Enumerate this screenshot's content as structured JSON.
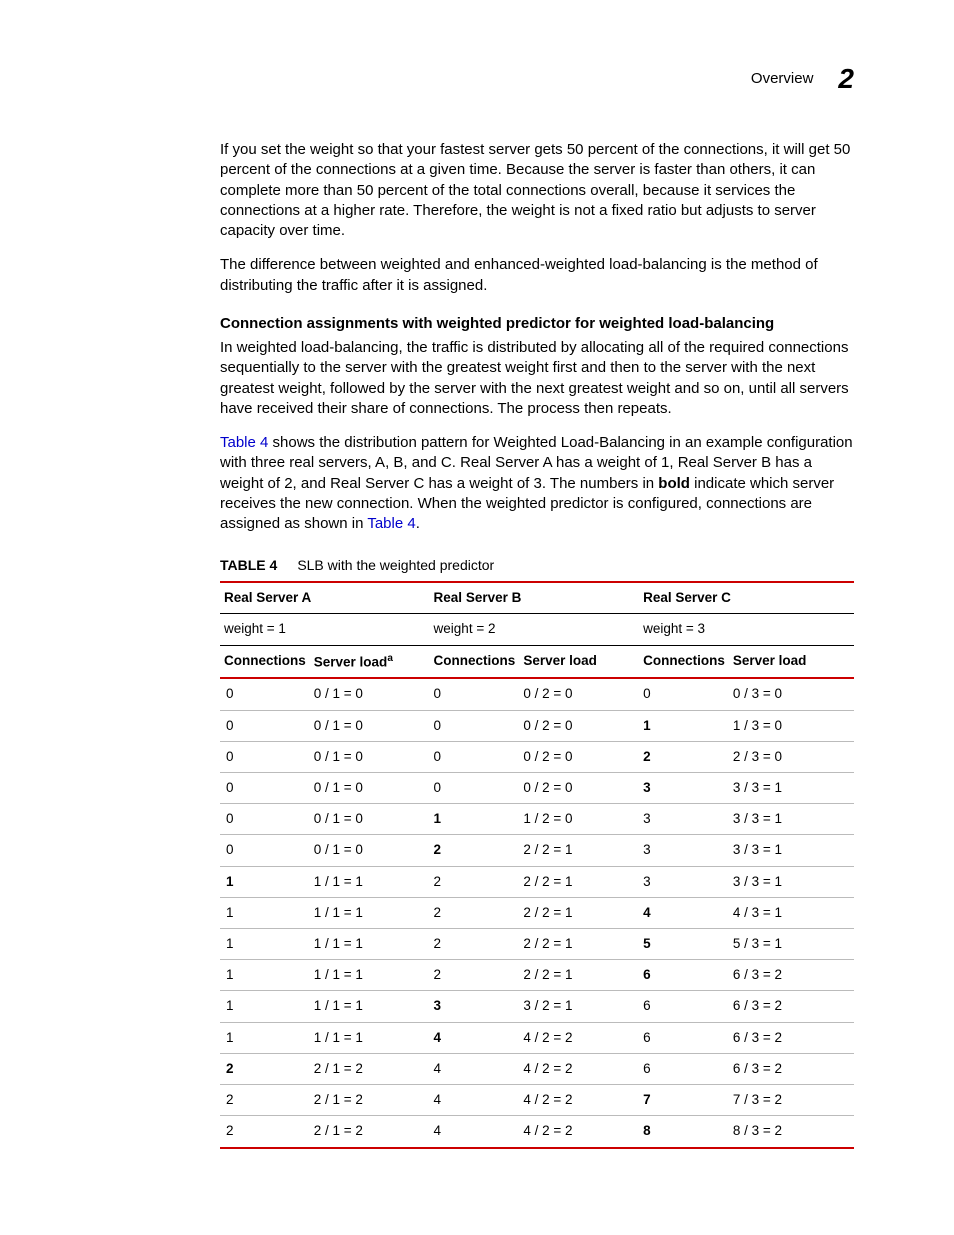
{
  "header": {
    "section": "Overview",
    "chapter": "2"
  },
  "paragraphs": {
    "p1": "If you set the weight so that your fastest server gets 50 percent of the connections, it will get 50 percent of the connections at a given time. Because the server is faster than others, it can complete more than 50 percent of the total connections overall, because it services the connections at a higher rate. Therefore, the weight is not a fixed ratio but adjusts to server capacity over time.",
    "p2": "The difference between weighted and enhanced-weighted load-balancing is the method of distributing the traffic after it is assigned.",
    "subhead": "Connection assignments with weighted predictor for weighted load-balancing",
    "p3": "In weighted load-balancing, the traffic is distributed by allocating all of the required connections sequentially to the server with the greatest weight first and then to the server with the next greatest weight, followed by the server with the next greatest weight and so on, until all servers have received their share of connections. The process then repeats.",
    "p4_link1": "Table 4",
    "p4_a": " shows the distribution pattern for Weighted Load-Balancing in an example configuration with three real servers, A, B, and C. Real Server A has a weight of 1, Real Server B has a weight of 2, and Real Server C has a weight of 3. The numbers in ",
    "p4_bold": "bold",
    "p4_b": " indicate which server receives the new connection. When the weighted predictor is configured, connections are assigned as shown in ",
    "p4_link2": "Table 4",
    "p4_c": "."
  },
  "table": {
    "caption_label": "TABLE 4",
    "caption_text": "SLB with the weighted predictor",
    "group_headers": [
      "Real Server A",
      "Real Server B",
      "Real Server C"
    ],
    "weight_headers": [
      "weight = 1",
      "weight = 2",
      "weight = 3"
    ],
    "col_headers": {
      "conn": "Connections",
      "load": "Server load",
      "load_a": "Server load",
      "sup": "a"
    },
    "rows": [
      {
        "a_c": "0",
        "a_b": false,
        "a_l": "0 / 1 = 0",
        "b_c": "0",
        "b_b": false,
        "b_l": "0 / 2 = 0",
        "c_c": "0",
        "c_b": false,
        "c_l": "0 / 3 = 0"
      },
      {
        "a_c": "0",
        "a_b": false,
        "a_l": "0 / 1 = 0",
        "b_c": "0",
        "b_b": false,
        "b_l": "0 / 2 = 0",
        "c_c": "1",
        "c_b": true,
        "c_l": "1 / 3 = 0"
      },
      {
        "a_c": "0",
        "a_b": false,
        "a_l": "0 / 1 = 0",
        "b_c": "0",
        "b_b": false,
        "b_l": "0 / 2 = 0",
        "c_c": "2",
        "c_b": true,
        "c_l": "2 / 3 = 0"
      },
      {
        "a_c": "0",
        "a_b": false,
        "a_l": "0 / 1 = 0",
        "b_c": "0",
        "b_b": false,
        "b_l": "0 / 2 = 0",
        "c_c": "3",
        "c_b": true,
        "c_l": "3 / 3 = 1"
      },
      {
        "a_c": "0",
        "a_b": false,
        "a_l": "0 / 1 = 0",
        "b_c": "1",
        "b_b": true,
        "b_l": "1 / 2 = 0",
        "c_c": "3",
        "c_b": false,
        "c_l": "3 / 3 = 1"
      },
      {
        "a_c": "0",
        "a_b": false,
        "a_l": "0 / 1 = 0",
        "b_c": "2",
        "b_b": true,
        "b_l": "2 / 2 = 1",
        "c_c": "3",
        "c_b": false,
        "c_l": "3 / 3 = 1"
      },
      {
        "a_c": "1",
        "a_b": true,
        "a_l": "1 / 1 = 1",
        "b_c": "2",
        "b_b": false,
        "b_l": "2 / 2 = 1",
        "c_c": "3",
        "c_b": false,
        "c_l": "3 / 3 = 1"
      },
      {
        "a_c": "1",
        "a_b": false,
        "a_l": "1 / 1 = 1",
        "b_c": "2",
        "b_b": false,
        "b_l": "2 / 2 = 1",
        "c_c": "4",
        "c_b": true,
        "c_l": "4 / 3 = 1"
      },
      {
        "a_c": "1",
        "a_b": false,
        "a_l": "1 / 1 = 1",
        "b_c": "2",
        "b_b": false,
        "b_l": "2 / 2 = 1",
        "c_c": "5",
        "c_b": true,
        "c_l": "5 / 3 = 1"
      },
      {
        "a_c": "1",
        "a_b": false,
        "a_l": "1 / 1 = 1",
        "b_c": "2",
        "b_b": false,
        "b_l": "2 / 2 = 1",
        "c_c": "6",
        "c_b": true,
        "c_l": "6 / 3 = 2"
      },
      {
        "a_c": "1",
        "a_b": false,
        "a_l": "1 / 1 = 1",
        "b_c": "3",
        "b_b": true,
        "b_l": "3 / 2 = 1",
        "c_c": "6",
        "c_b": false,
        "c_l": "6 / 3 = 2"
      },
      {
        "a_c": "1",
        "a_b": false,
        "a_l": "1 / 1 = 1",
        "b_c": "4",
        "b_b": true,
        "b_l": "4 / 2 = 2",
        "c_c": "6",
        "c_b": false,
        "c_l": "6 / 3 = 2"
      },
      {
        "a_c": "2",
        "a_b": true,
        "a_l": "2 / 1 = 2",
        "b_c": "4",
        "b_b": false,
        "b_l": "4 / 2 = 2",
        "c_c": "6",
        "c_b": false,
        "c_l": "6 / 3 = 2"
      },
      {
        "a_c": "2",
        "a_b": false,
        "a_l": "2 / 1 = 2",
        "b_c": "4",
        "b_b": false,
        "b_l": "4 / 2 = 2",
        "c_c": "7",
        "c_b": true,
        "c_l": "7 / 3 = 2"
      },
      {
        "a_c": "2",
        "a_b": false,
        "a_l": "2 / 1 = 2",
        "b_c": "4",
        "b_b": false,
        "b_l": "4 / 2 = 2",
        "c_c": "8",
        "c_b": true,
        "c_l": "8 / 3 = 2"
      }
    ]
  }
}
